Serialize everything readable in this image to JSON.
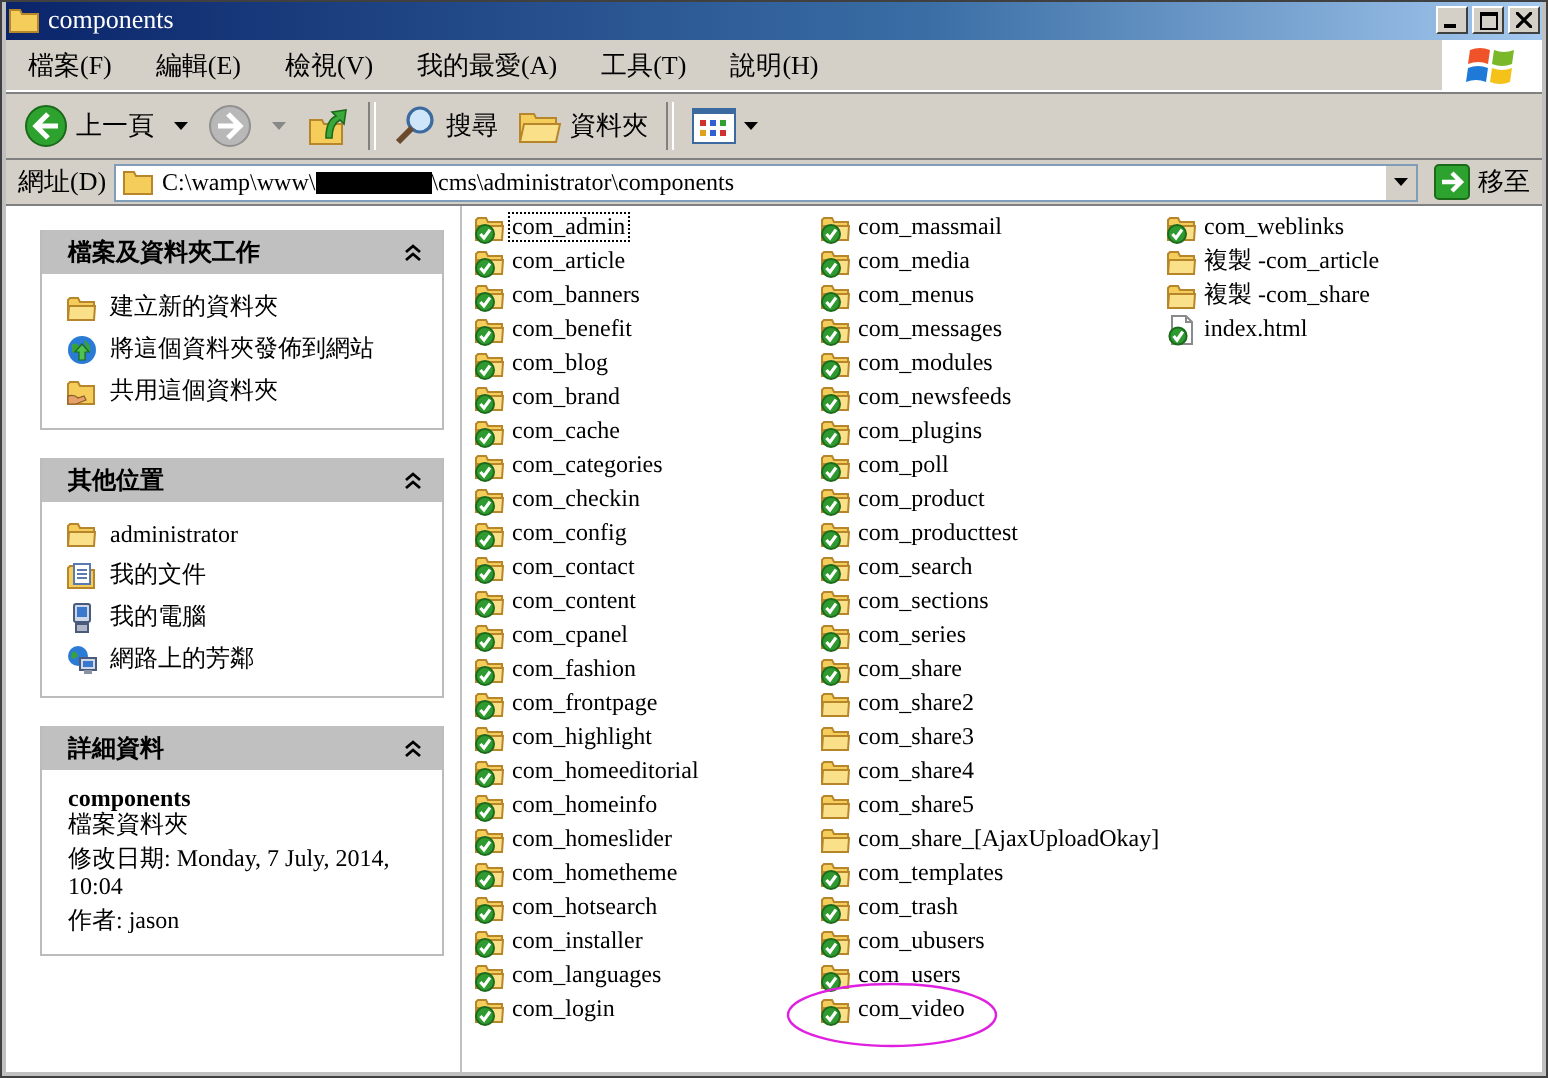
{
  "window": {
    "title": "components"
  },
  "menu": [
    "檔案(F)",
    "編輯(E)",
    "檢視(V)",
    "我的最愛(A)",
    "工具(T)",
    "說明(H)"
  ],
  "toolbar": {
    "back": {
      "label": "上一頁",
      "disabled": false
    },
    "forward": {
      "disabled": true
    },
    "search": "搜尋",
    "folders": "資料夾"
  },
  "address": {
    "label": "網址(D)",
    "path_start": "C:\\wamp\\www\\",
    "redacted": true,
    "path_end": "\\cms\\administrator\\components",
    "go": "移至"
  },
  "task_panels": [
    {
      "kind": "tasks",
      "title": "檔案及資料夾工作",
      "expanded": true,
      "items": [
        {
          "label": "建立新的資料夾",
          "kind": "new-folder"
        },
        {
          "label": "將這個資料夾發佈到網站",
          "kind": "publish"
        },
        {
          "label": "共用這個資料夾",
          "kind": "share-folder"
        }
      ]
    },
    {
      "kind": "tasks",
      "title": "其他位置",
      "expanded": true,
      "items": [
        {
          "label": "administrator",
          "kind": "folder"
        },
        {
          "label": "我的文件",
          "kind": "documents"
        },
        {
          "label": "我的電腦",
          "kind": "computer"
        },
        {
          "label": "網路上的芳鄰",
          "kind": "network"
        }
      ]
    },
    {
      "kind": "details",
      "title": "詳細資料",
      "expanded": true,
      "name": "components",
      "type": "檔案資料夾",
      "modified": "修改日期: Monday, 7 July, 2014, 10:04",
      "author": "作者: jason"
    }
  ],
  "files": [
    {
      "name": "com_admin",
      "kind": "svn-folder",
      "focused": true,
      "circled": false
    },
    {
      "name": "com_article",
      "kind": "svn-folder",
      "focused": false,
      "circled": false
    },
    {
      "name": "com_banners",
      "kind": "svn-folder",
      "focused": false,
      "circled": false
    },
    {
      "name": "com_benefit",
      "kind": "svn-folder",
      "focused": false,
      "circled": false
    },
    {
      "name": "com_blog",
      "kind": "svn-folder",
      "focused": false,
      "circled": false
    },
    {
      "name": "com_brand",
      "kind": "svn-folder",
      "focused": false,
      "circled": false
    },
    {
      "name": "com_cache",
      "kind": "svn-folder",
      "focused": false,
      "circled": false
    },
    {
      "name": "com_categories",
      "kind": "svn-folder",
      "focused": false,
      "circled": false
    },
    {
      "name": "com_checkin",
      "kind": "svn-folder",
      "focused": false,
      "circled": false
    },
    {
      "name": "com_config",
      "kind": "svn-folder",
      "focused": false,
      "circled": false
    },
    {
      "name": "com_contact",
      "kind": "svn-folder",
      "focused": false,
      "circled": false
    },
    {
      "name": "com_content",
      "kind": "svn-folder",
      "focused": false,
      "circled": false
    },
    {
      "name": "com_cpanel",
      "kind": "svn-folder",
      "focused": false,
      "circled": false
    },
    {
      "name": "com_fashion",
      "kind": "svn-folder",
      "focused": false,
      "circled": false
    },
    {
      "name": "com_frontpage",
      "kind": "svn-folder",
      "focused": false,
      "circled": false
    },
    {
      "name": "com_highlight",
      "kind": "svn-folder",
      "focused": false,
      "circled": false
    },
    {
      "name": "com_homeeditorial",
      "kind": "svn-folder",
      "focused": false,
      "circled": false
    },
    {
      "name": "com_homeinfo",
      "kind": "svn-folder",
      "focused": false,
      "circled": false
    },
    {
      "name": "com_homeslider",
      "kind": "svn-folder",
      "focused": false,
      "circled": false
    },
    {
      "name": "com_hometheme",
      "kind": "svn-folder",
      "focused": false,
      "circled": false
    },
    {
      "name": "com_hotsearch",
      "kind": "svn-folder",
      "focused": false,
      "circled": false
    },
    {
      "name": "com_installer",
      "kind": "svn-folder",
      "focused": false,
      "circled": false
    },
    {
      "name": "com_languages",
      "kind": "svn-folder",
      "focused": false,
      "circled": false
    },
    {
      "name": "com_login",
      "kind": "svn-folder",
      "focused": false,
      "circled": false
    },
    {
      "name": "com_massmail",
      "kind": "svn-folder",
      "focused": false,
      "circled": false
    },
    {
      "name": "com_media",
      "kind": "svn-folder",
      "focused": false,
      "circled": false
    },
    {
      "name": "com_menus",
      "kind": "svn-folder",
      "focused": false,
      "circled": false
    },
    {
      "name": "com_messages",
      "kind": "svn-folder",
      "focused": false,
      "circled": false
    },
    {
      "name": "com_modules",
      "kind": "svn-folder",
      "focused": false,
      "circled": false
    },
    {
      "name": "com_newsfeeds",
      "kind": "svn-folder",
      "focused": false,
      "circled": false
    },
    {
      "name": "com_plugins",
      "kind": "svn-folder",
      "focused": false,
      "circled": false
    },
    {
      "name": "com_poll",
      "kind": "svn-folder",
      "focused": false,
      "circled": false
    },
    {
      "name": "com_product",
      "kind": "svn-folder",
      "focused": false,
      "circled": false
    },
    {
      "name": "com_producttest",
      "kind": "svn-folder",
      "focused": false,
      "circled": false
    },
    {
      "name": "com_search",
      "kind": "svn-folder",
      "focused": false,
      "circled": false
    },
    {
      "name": "com_sections",
      "kind": "svn-folder",
      "focused": false,
      "circled": false
    },
    {
      "name": "com_series",
      "kind": "svn-folder",
      "focused": false,
      "circled": false
    },
    {
      "name": "com_share",
      "kind": "svn-folder",
      "focused": false,
      "circled": false
    },
    {
      "name": "com_share2",
      "kind": "folder",
      "focused": false,
      "circled": false
    },
    {
      "name": "com_share3",
      "kind": "folder",
      "focused": false,
      "circled": false
    },
    {
      "name": "com_share4",
      "kind": "folder",
      "focused": false,
      "circled": false
    },
    {
      "name": "com_share5",
      "kind": "folder",
      "focused": false,
      "circled": false
    },
    {
      "name": "com_share_[AjaxUploadOkay]",
      "kind": "folder",
      "focused": false,
      "circled": false
    },
    {
      "name": "com_templates",
      "kind": "svn-folder",
      "focused": false,
      "circled": false
    },
    {
      "name": "com_trash",
      "kind": "svn-folder",
      "focused": false,
      "circled": false
    },
    {
      "name": "com_ubusers",
      "kind": "svn-folder",
      "focused": false,
      "circled": false
    },
    {
      "name": "com_users",
      "kind": "svn-folder",
      "focused": false,
      "circled": false
    },
    {
      "name": "com_video",
      "kind": "svn-folder",
      "focused": false,
      "circled": true
    },
    {
      "name": "com_weblinks",
      "kind": "svn-folder",
      "focused": false,
      "circled": false
    },
    {
      "name": "複製 -com_article",
      "kind": "folder",
      "focused": false,
      "circled": false
    },
    {
      "name": "複製 -com_share",
      "kind": "folder",
      "focused": false,
      "circled": false
    },
    {
      "name": "index.html",
      "kind": "svn-file",
      "focused": false,
      "circled": false
    }
  ]
}
